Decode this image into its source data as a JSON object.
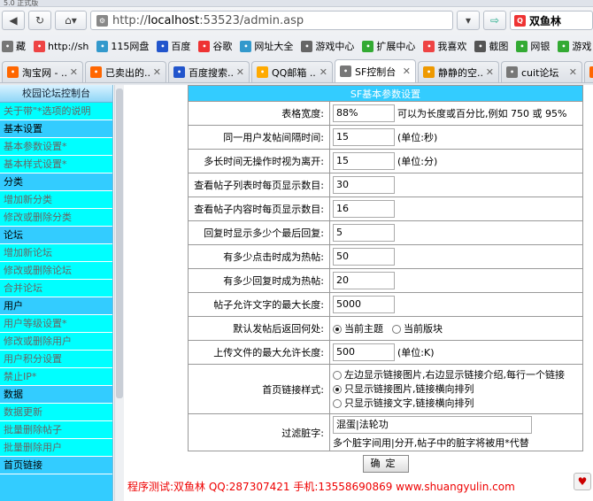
{
  "browser": {
    "title_fragment": "5.0 正式版",
    "url_scheme": "http://",
    "url_host": "localhost",
    "url_rest": ":53523/admin.asp",
    "search_text": "双鱼林",
    "bookmarks": [
      {
        "icon": "cut-icon",
        "label": "藏",
        "color": "#777"
      },
      {
        "icon": "hao123-icon",
        "label": "http://sh",
        "color": "#e44"
      },
      {
        "icon": "115-icon",
        "label": "115网盘",
        "color": "#39c"
      },
      {
        "icon": "paw-icon",
        "label": "百度",
        "color": "#25c"
      },
      {
        "icon": "gu-icon",
        "label": "谷歌",
        "color": "#e33"
      },
      {
        "icon": "web-icon",
        "label": "网址大全",
        "color": "#39c"
      },
      {
        "icon": "game-icon",
        "label": "游戏中心",
        "color": "#666"
      },
      {
        "icon": "ext-icon",
        "label": "扩展中心",
        "color": "#3a3"
      },
      {
        "icon": "heart-icon",
        "label": "我喜欢",
        "color": "#e44"
      },
      {
        "icon": "screenshot-icon",
        "label": "截图",
        "color": "#555"
      },
      {
        "icon": "shield-icon",
        "label": "网银",
        "color": "#3a3"
      },
      {
        "icon": "gamepad-icon",
        "label": "游戏",
        "color": "#3a3"
      }
    ],
    "tabs": [
      {
        "label": "淘宝网 - ...",
        "icon": "taobao-icon",
        "color": "#f60",
        "active": false
      },
      {
        "label": "已卖出的...",
        "icon": "taobao-icon",
        "color": "#f60",
        "active": false
      },
      {
        "label": "百度搜索...",
        "icon": "paw-icon",
        "color": "#25c",
        "active": false
      },
      {
        "label": "QQ邮箱 ...",
        "icon": "qq-icon",
        "color": "#fa0",
        "active": false
      },
      {
        "label": "SF控制台",
        "icon": "settings-icon",
        "color": "#777",
        "active": true
      },
      {
        "label": "静静的空...",
        "icon": "star-icon",
        "color": "#e90",
        "active": false
      },
      {
        "label": "cuit论坛",
        "icon": "settings-icon",
        "color": "#777",
        "active": false
      },
      {
        "label": "",
        "icon": "taobao-icon",
        "color": "#f60",
        "active": false
      }
    ]
  },
  "sidebar": {
    "title": "校园论坛控制台",
    "items": [
      {
        "type": "item",
        "label": "关于带\"*选项的说明"
      },
      {
        "type": "head",
        "label": "基本设置"
      },
      {
        "type": "item",
        "label": "基本参数设置*"
      },
      {
        "type": "item",
        "label": "基本样式设置*"
      },
      {
        "type": "head",
        "label": "分类"
      },
      {
        "type": "item",
        "label": "增加新分类"
      },
      {
        "type": "item",
        "label": "修改或删除分类"
      },
      {
        "type": "head",
        "label": "论坛"
      },
      {
        "type": "item",
        "label": "增加新论坛"
      },
      {
        "type": "item",
        "label": "修改或删除论坛"
      },
      {
        "type": "item",
        "label": "合并论坛"
      },
      {
        "type": "head",
        "label": "用户"
      },
      {
        "type": "item",
        "label": "用户等级设置*"
      },
      {
        "type": "item",
        "label": "修改或删除用户"
      },
      {
        "type": "item",
        "label": "用户积分设置"
      },
      {
        "type": "item",
        "label": "禁止IP*"
      },
      {
        "type": "head",
        "label": "数据"
      },
      {
        "type": "item",
        "label": "数据更新"
      },
      {
        "type": "item",
        "label": "批量删除帖子"
      },
      {
        "type": "item",
        "label": "批量删除用户"
      },
      {
        "type": "head",
        "label": "首页链接"
      }
    ]
  },
  "form": {
    "title": "SF基本参数设置",
    "rows": [
      {
        "label": "表格宽度:",
        "value": "88%",
        "hint": "可以为长度或百分比,例如  750 或  95%"
      },
      {
        "label": "同一用户发帖间隔时间:",
        "value": "15",
        "hint": "(单位:秒)"
      },
      {
        "label": "多长时间无操作时视为离开:",
        "value": "15",
        "hint": "(单位:分)"
      },
      {
        "label": "查看帖子列表时每页显示数目:",
        "value": "30",
        "hint": ""
      },
      {
        "label": "查看帖子内容时每页显示数目:",
        "value": "16",
        "hint": ""
      },
      {
        "label": "回复时显示多少个最后回复:",
        "value": "5",
        "hint": ""
      },
      {
        "label": "有多少点击时成为热帖:",
        "value": "50",
        "hint": ""
      },
      {
        "label": "有多少回复时成为热帖:",
        "value": "20",
        "hint": ""
      },
      {
        "label": "帖子允许文字的最大长度:",
        "value": "5000",
        "hint": ""
      }
    ],
    "return_label": "默认发帖后返回何处:",
    "return_options": [
      {
        "label": "当前主题",
        "checked": true
      },
      {
        "label": "当前版块",
        "checked": false
      }
    ],
    "upload_label": "上传文件的最大允许长度:",
    "upload_value": "500",
    "upload_hint": "(单位:K)",
    "link_label": "首页链接样式:",
    "link_options": [
      {
        "label": "左边显示链接图片,右边显示链接介绍,每行一个链接",
        "checked": false
      },
      {
        "label": "只显示链接图片,链接横向排列",
        "checked": true
      },
      {
        "label": "只显示链接文字,链接横向排列",
        "checked": false
      }
    ],
    "filter_label": "过滤脏字:",
    "filter_value": "混蛋|法轮功",
    "filter_hint": "多个脏字间用|分开,帖子中的脏字将被用*代替",
    "submit_label": "确定"
  },
  "footer": "程序测试:双鱼林 QQ:287307421 手机:13558690869 www.shuangyulin.com"
}
